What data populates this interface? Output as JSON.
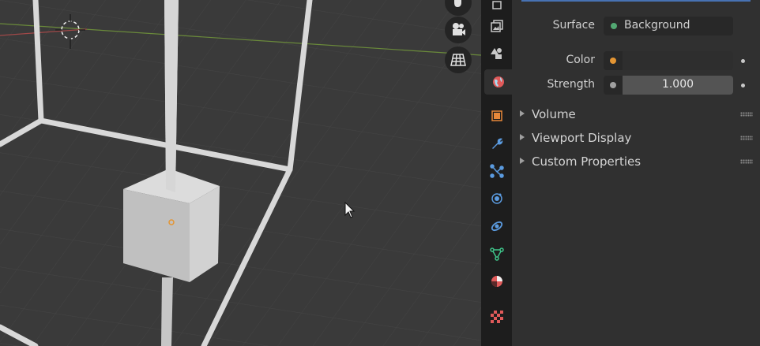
{
  "viewport_tools": [
    {
      "name": "pan-hand-icon"
    },
    {
      "name": "camera-view-icon"
    },
    {
      "name": "grid-view-icon"
    }
  ],
  "property_tabs": [
    {
      "name": "tab-output-icon",
      "color": "#c8c8c8"
    },
    {
      "name": "tab-view-layer-icon",
      "color": "#c8c8c8"
    },
    {
      "name": "tab-scene-icon",
      "color": "#c8c8c8"
    },
    {
      "name": "tab-world-icon",
      "color": "#e05a5a",
      "active": true
    },
    {
      "name": "tab-object-icon",
      "color": "#e8883a"
    },
    {
      "name": "tab-modifiers-icon",
      "color": "#5b9be0"
    },
    {
      "name": "tab-particles-icon",
      "color": "#5b9be0"
    },
    {
      "name": "tab-physics-icon",
      "color": "#5b9be0"
    },
    {
      "name": "tab-constraints-icon",
      "color": "#5b9be0"
    },
    {
      "name": "tab-data-icon",
      "color": "#3ec48a"
    },
    {
      "name": "tab-material-icon",
      "color": "#e05a5a"
    },
    {
      "name": "tab-texture-icon",
      "color": "#e05a5a"
    }
  ],
  "surface": {
    "label": "Surface",
    "value": "Background",
    "dot_color": "#52a872"
  },
  "color": {
    "label": "Color",
    "dot_color": "#e49533"
  },
  "strength": {
    "label": "Strength",
    "value": "1.000",
    "dot_color": "#a0a0a0"
  },
  "panels": [
    {
      "title": "Volume"
    },
    {
      "title": "Viewport Display"
    },
    {
      "title": "Custom Properties"
    }
  ]
}
